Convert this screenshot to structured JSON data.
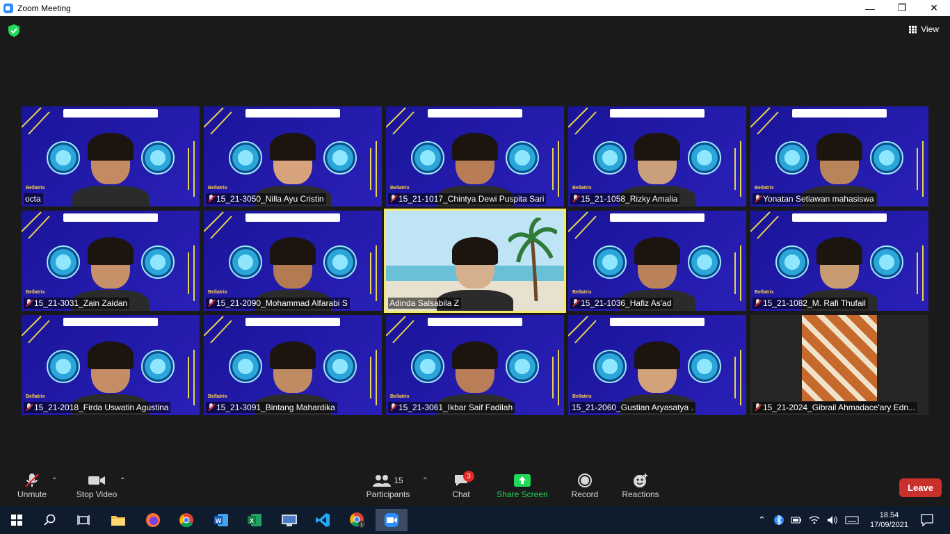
{
  "window": {
    "title": "Zoom Meeting"
  },
  "meeting": {
    "view_label": "View"
  },
  "tiles": [
    {
      "name": "octa",
      "muted": false,
      "highlight": false
    },
    {
      "name": "15_21-3050_Nilla Ayu Cristin",
      "muted": true,
      "highlight": false
    },
    {
      "name": "15_21-1017_Chintya Dewi Puspita Sari",
      "muted": true,
      "highlight": false
    },
    {
      "name": "15_21-1058_Rizky Amalia",
      "muted": true,
      "highlight": false
    },
    {
      "name": "Yonatan Setiawan mahasiswa",
      "muted": true,
      "highlight": false
    },
    {
      "name": "15_21-3031_Zain Zaidan",
      "muted": true,
      "highlight": false
    },
    {
      "name": "15_21-2090_Mohammad Alfarabi S",
      "muted": true,
      "highlight": false
    },
    {
      "name": "Adinda Salsabila Z",
      "muted": false,
      "highlight": true
    },
    {
      "name": "15_21-1036_Hafiz As'ad",
      "muted": true,
      "highlight": false
    },
    {
      "name": "15_21-1082_M. Rafi Thufail",
      "muted": true,
      "highlight": false
    },
    {
      "name": "15_21-2018_Firda Uswatin Agustina",
      "muted": true,
      "highlight": false
    },
    {
      "name": "15_21-3091_Bintang Mahardika",
      "muted": true,
      "highlight": false
    },
    {
      "name": "15_21-3061_Ikbar Saif Fadilah",
      "muted": true,
      "highlight": false
    },
    {
      "name": "15_21-2060_Gustian Aryasatya .",
      "muted": false,
      "highlight": false
    },
    {
      "name": "15_21-2024_Gibrail Ahmadace'ary Edn...",
      "muted": true,
      "highlight": false
    }
  ],
  "toolbar": {
    "unmute": "Unmute",
    "stop_video": "Stop Video",
    "participants": "Participants",
    "participants_count": "15",
    "chat": "Chat",
    "chat_badge": "3",
    "share_screen": "Share Screen",
    "record": "Record",
    "reactions": "Reactions",
    "leave": "Leave"
  },
  "colors": {
    "accent_green": "#23d959",
    "leave_red": "#c9302c",
    "highlight_yellow": "#f5e96a",
    "tile_blue": "#1a1499"
  },
  "taskbar": {
    "time": "18.54",
    "date": "17/09/2021",
    "chrome_badge": "1"
  }
}
